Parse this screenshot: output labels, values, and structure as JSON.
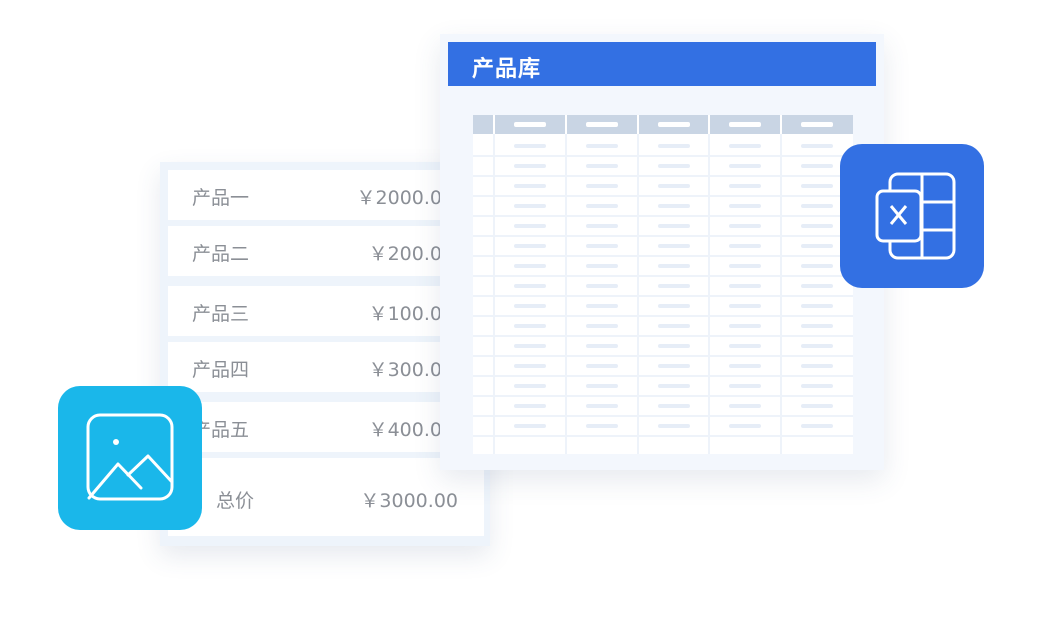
{
  "price_list": {
    "rows": [
      {
        "name": "产品一",
        "price": "￥2000.0"
      },
      {
        "name": "产品二",
        "price": "￥200.0"
      },
      {
        "name": "产品三",
        "price": "￥100.0"
      },
      {
        "name": "产品四",
        "price": "￥300.0"
      },
      {
        "name": "产品五",
        "price": "￥400.0"
      }
    ],
    "total": {
      "label": "总价",
      "price": "￥3000.00"
    }
  },
  "product_library": {
    "title": "产品库",
    "columns": 6,
    "rows": 15
  },
  "icons": {
    "excel_tile": "spreadsheet-x-icon",
    "image_tile": "image-icon"
  },
  "colors": {
    "brand_blue": "#3370e3",
    "image_tile_blue": "#1ab7ea",
    "grid_header": "#c9d5e4",
    "card_bg": "#eef4fb"
  }
}
